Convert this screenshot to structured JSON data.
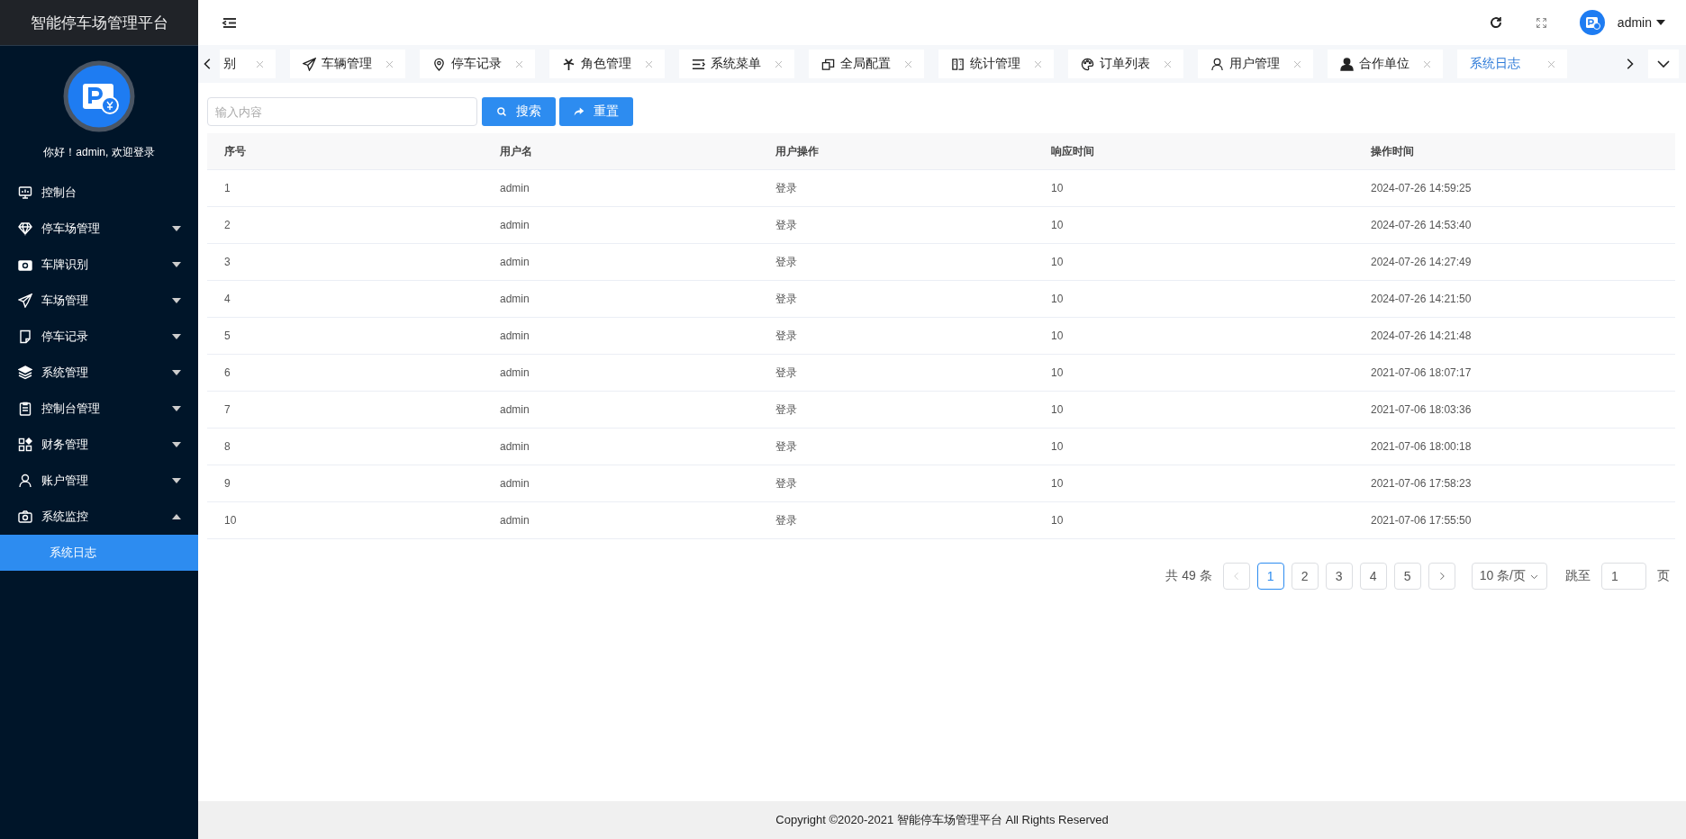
{
  "sidebar": {
    "title": "智能停车场管理平台",
    "greeting": "你好！admin, 欢迎登录",
    "items": [
      {
        "label": "控制台",
        "kind": "link"
      },
      {
        "label": "停车场管理",
        "kind": "submenu",
        "expanded": false
      },
      {
        "label": "车牌识别",
        "kind": "submenu",
        "expanded": false
      },
      {
        "label": "车场管理",
        "kind": "submenu",
        "expanded": false
      },
      {
        "label": "停车记录",
        "kind": "submenu",
        "expanded": false
      },
      {
        "label": "系统管理",
        "kind": "submenu",
        "expanded": false
      },
      {
        "label": "控制台管理",
        "kind": "submenu",
        "expanded": false
      },
      {
        "label": "财务管理",
        "kind": "submenu",
        "expanded": false
      },
      {
        "label": "账户管理",
        "kind": "submenu",
        "expanded": false
      },
      {
        "label": "系统监控",
        "kind": "submenu",
        "expanded": true,
        "children": [
          {
            "label": "系统日志",
            "selected": true
          }
        ]
      }
    ]
  },
  "header": {
    "user": "admin"
  },
  "tabs": [
    {
      "label": "别",
      "selected": false
    },
    {
      "label": "车辆管理",
      "selected": false
    },
    {
      "label": "停车记录",
      "selected": false
    },
    {
      "label": "角色管理",
      "selected": false
    },
    {
      "label": "系统菜单",
      "selected": false
    },
    {
      "label": "全局配置",
      "selected": false
    },
    {
      "label": "统计管理",
      "selected": false
    },
    {
      "label": "订单列表",
      "selected": false
    },
    {
      "label": "用户管理",
      "selected": false
    },
    {
      "label": "合作单位",
      "selected": false
    },
    {
      "label": "系统日志",
      "selected": true
    }
  ],
  "search": {
    "placeholder": "输入内容",
    "buttons": [
      "搜索",
      "重置"
    ]
  },
  "table": {
    "columns": [
      "序号",
      "用户名",
      "用户操作",
      "响应时间",
      "操作时间"
    ],
    "rows": [
      [
        "1",
        "admin",
        "登录",
        "10",
        "2024-07-26 14:59:25"
      ],
      [
        "2",
        "admin",
        "登录",
        "10",
        "2024-07-26 14:53:40"
      ],
      [
        "3",
        "admin",
        "登录",
        "10",
        "2024-07-26 14:27:49"
      ],
      [
        "4",
        "admin",
        "登录",
        "10",
        "2024-07-26 14:21:50"
      ],
      [
        "5",
        "admin",
        "登录",
        "10",
        "2024-07-26 14:21:48"
      ],
      [
        "6",
        "admin",
        "登录",
        "10",
        "2021-07-06 18:07:17"
      ],
      [
        "7",
        "admin",
        "登录",
        "10",
        "2021-07-06 18:03:36"
      ],
      [
        "8",
        "admin",
        "登录",
        "10",
        "2021-07-06 18:00:18"
      ],
      [
        "9",
        "admin",
        "登录",
        "10",
        "2021-07-06 17:58:23"
      ],
      [
        "10",
        "admin",
        "登录",
        "10",
        "2021-07-06 17:55:50"
      ]
    ]
  },
  "pagination": {
    "total": "共 49 条",
    "prev_disabled": true,
    "next_disabled": false,
    "pages": [
      {
        "label": "1",
        "selected": true
      },
      {
        "label": "2",
        "selected": false
      },
      {
        "label": "3",
        "selected": false
      },
      {
        "label": "4",
        "selected": false
      },
      {
        "label": "5",
        "selected": false
      }
    ],
    "page_size": "10 条/页",
    "jump_label": "跳至",
    "jump_value": "1",
    "jump_unit": "页"
  },
  "footer": "Copyright ©2020-2021 智能停车场管理平台 All Rights Reserved"
}
